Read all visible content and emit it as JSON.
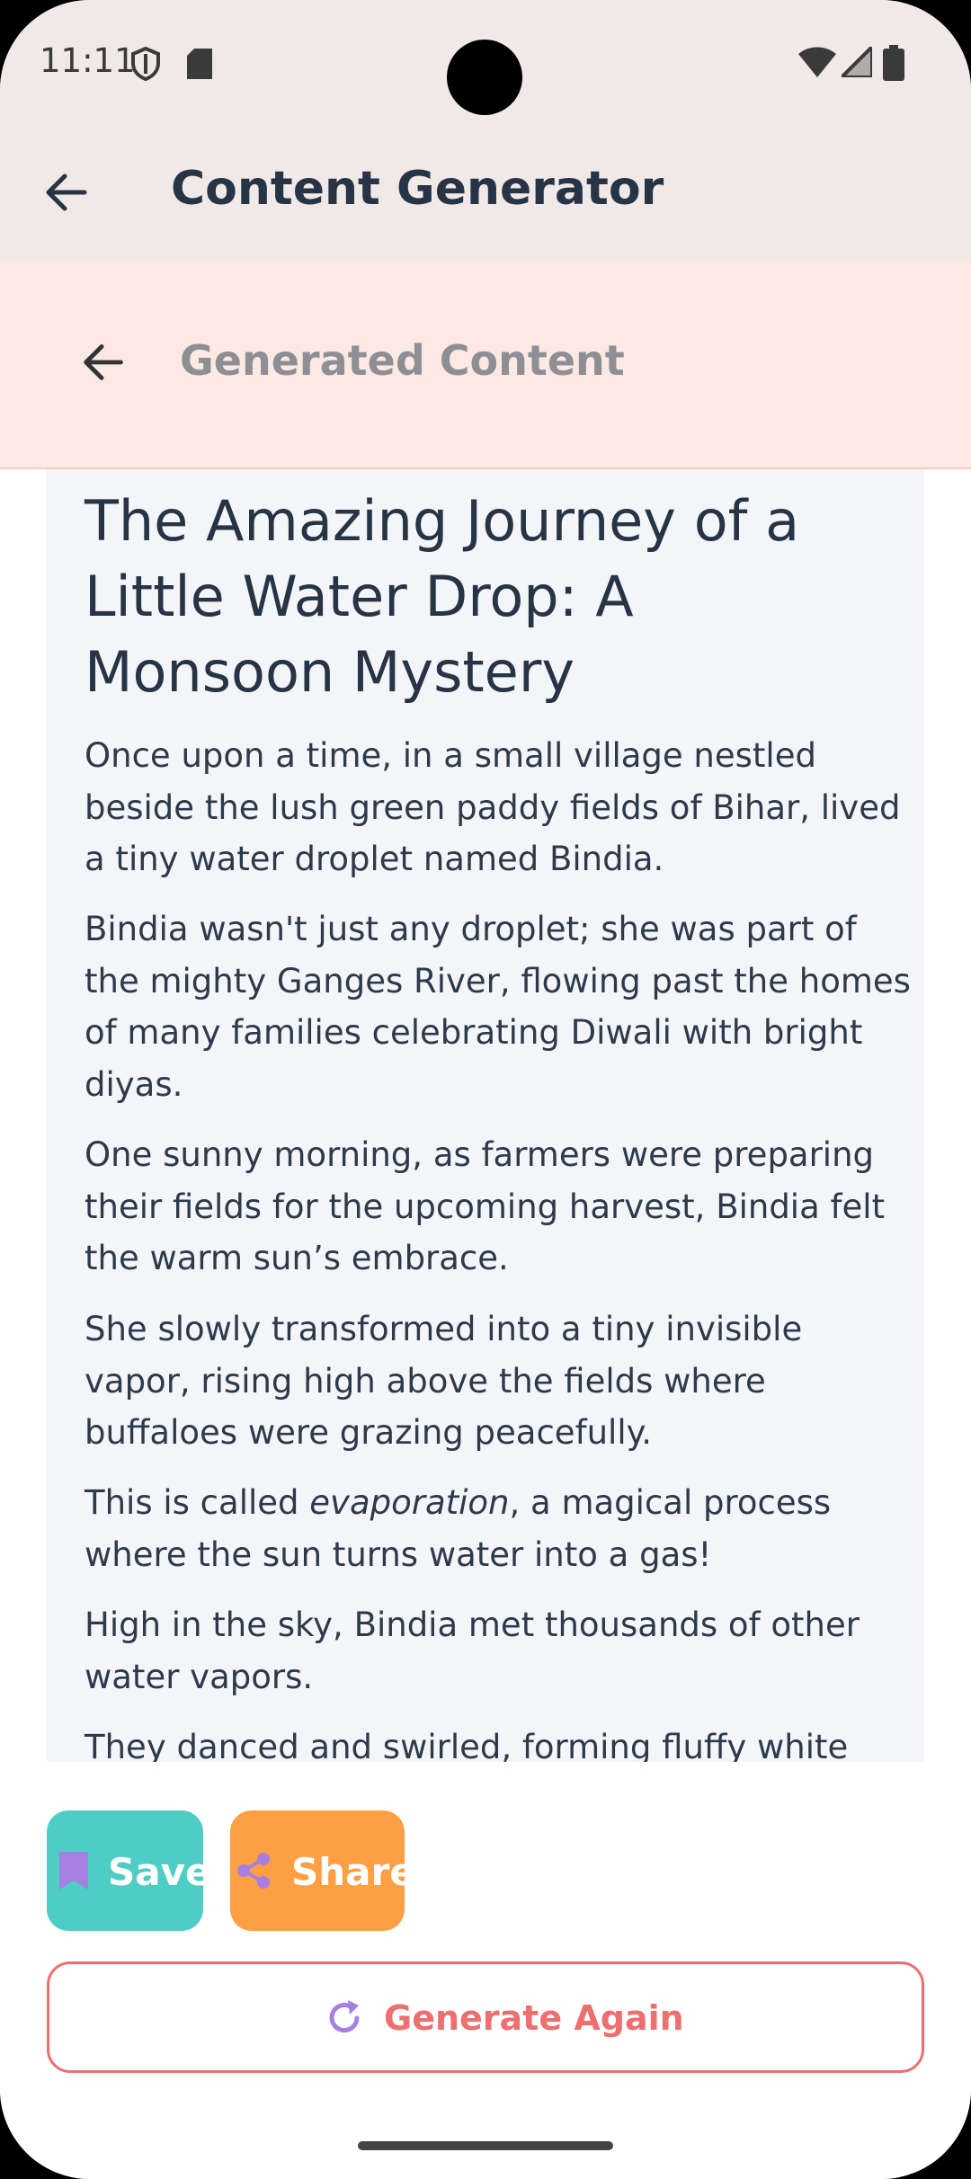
{
  "status_bar": {
    "time": "11:11",
    "left_icons": [
      "shield-icon",
      "sd-card-icon"
    ],
    "right_icons": [
      "wifi-icon",
      "signal-icon",
      "battery-icon"
    ]
  },
  "app_bar": {
    "title": "Content Generator",
    "back_icon": "arrow-back-icon"
  },
  "sub_header": {
    "title": "Generated Content",
    "back_icon": "arrow-back-icon"
  },
  "content": {
    "title": "The Amazing Journey of a Little Water Drop: A Monsoon Mystery",
    "paragraphs": [
      "Once upon a time, in a small village nestled beside the lush green paddy fields of Bihar, lived a tiny water droplet named Bindia.",
      "Bindia wasn't just any droplet; she was part of the mighty Ganges River, flowing past the homes of many families celebrating Diwali with bright diyas.",
      "One sunny morning, as farmers were preparing their fields for the upcoming harvest,  Bindia felt the warm sun’s embrace.",
      "She slowly transformed into a tiny invisible vapor, rising high above the fields where buffaloes were grazing peacefully.",
      {
        "before": "This is called ",
        "emphasis": "evaporation",
        "after": ", a magical process where the sun turns water into a gas!"
      },
      "High in the sky, Bindia met thousands of other water vapors.",
      "They danced and swirled, forming fluffy white"
    ]
  },
  "actions": {
    "save_label": "Save",
    "share_label": "Share",
    "generate_again_label": "Generate Again"
  },
  "colors": {
    "app_bar_bg": "#f0e9e7",
    "sub_header_bg": "#fde9e4",
    "card_bg": "#f4f5f9",
    "title_text": "#263445",
    "save_bg": "#4ecdc4",
    "share_bg": "#ff9f43",
    "generate_accent": "#ee6f6f",
    "icon_purple": "#a77fe0"
  }
}
